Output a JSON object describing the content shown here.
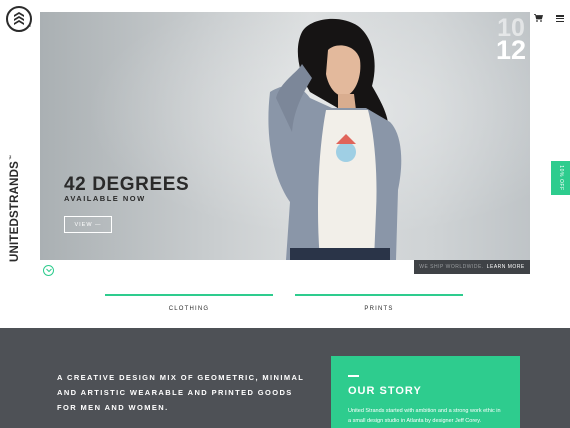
{
  "brand": {
    "name": "UNITEDSTRANDS",
    "tm": "™",
    "logo_icon": "chevrons-badge-icon"
  },
  "header": {
    "cart_icon": "cart-icon",
    "menu_icon": "hamburger-menu-icon"
  },
  "hero": {
    "title": "42 DEGREES",
    "subtitle": "AVAILABLE NOW",
    "button_label": "VIEW —",
    "date_top": "10",
    "date_bottom": "12",
    "ship_text": "WE SHIP WORLDWIDE.",
    "ship_link": "LEARN MORE",
    "scroll_icon": "chevron-down-icon"
  },
  "promo": {
    "label": "10% OFF"
  },
  "categories": [
    {
      "label": "CLOTHING"
    },
    {
      "label": "PRINTS"
    }
  ],
  "about": {
    "tagline": "A CREATIVE DESIGN MIX OF GEOMETRIC, MINIMAL AND ARTISTIC WEARABLE AND PRINTED GOODS FOR MEN AND WOMEN.",
    "story_title": "OUR STORY",
    "story_body": "United Strands started with ambition and a strong work ethic in a small design studio in Atlanta by designer Jeff Corey."
  },
  "colors": {
    "accent": "#2ecc8e",
    "dark_band": "#4e5156",
    "text_dark": "#2b2b2b"
  }
}
